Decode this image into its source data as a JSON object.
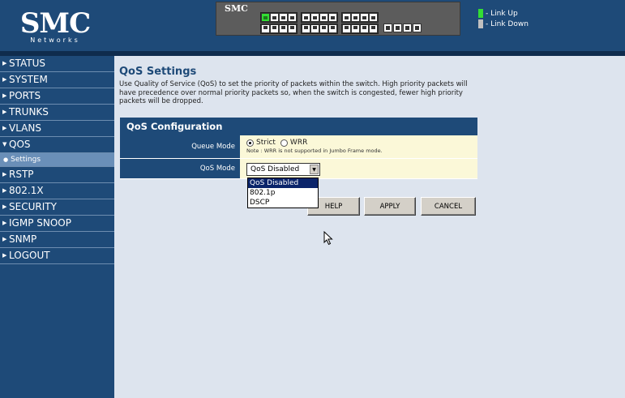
{
  "header": {
    "logo_text": "SMC",
    "logo_subtext": "Networks",
    "switch_brand": "SMC",
    "legend": [
      {
        "label": "- Link Up",
        "color": "#33dd33"
      },
      {
        "label": "- Link Down",
        "color": "#c0c0c0"
      }
    ]
  },
  "sidebar": {
    "items": [
      {
        "label": "STATUS",
        "icon": "triangle-right-icon"
      },
      {
        "label": "SYSTEM",
        "icon": "triangle-right-icon"
      },
      {
        "label": "PORTS",
        "icon": "triangle-right-icon"
      },
      {
        "label": "TRUNKS",
        "icon": "triangle-right-icon"
      },
      {
        "label": "VLANS",
        "icon": "triangle-right-icon"
      },
      {
        "label": "QOS",
        "icon": "triangle-down-icon"
      },
      {
        "label": "Settings",
        "icon": "bullet-icon"
      },
      {
        "label": "RSTP",
        "icon": "triangle-right-icon"
      },
      {
        "label": "802.1X",
        "icon": "triangle-right-icon"
      },
      {
        "label": "SECURITY",
        "icon": "triangle-right-icon"
      },
      {
        "label": "IGMP SNOOP",
        "icon": "triangle-right-icon"
      },
      {
        "label": "SNMP",
        "icon": "triangle-right-icon"
      },
      {
        "label": "LOGOUT",
        "icon": "triangle-right-icon"
      }
    ]
  },
  "main": {
    "title": "QoS Settings",
    "description": "Use Quality of Service (QoS) to set the priority of packets within the switch. High priority packets will have precedence over normal priority packets so, when the switch is congested, fewer high priority packets will be dropped.",
    "config": {
      "header": "QoS Configuration",
      "queue_mode_label": "Queue Mode",
      "strict_label": "Strict",
      "wrr_label": "WRR",
      "selected_queue_mode": "Strict",
      "note": "Note : WRR is not supported in Jumbo Frame mode.",
      "qos_mode_label": "QoS Mode",
      "qos_mode_value": "QoS Disabled",
      "qos_mode_options": [
        "QoS Disabled",
        "802.1p",
        "DSCP"
      ]
    },
    "buttons": {
      "help": "HELP",
      "apply": "APPLY",
      "cancel": "CANCEL"
    }
  },
  "colors": {
    "navy": "#1e4a78",
    "content_bg": "#dde4ee",
    "value_bg": "#fbf8d8",
    "link_up": "#33dd33"
  }
}
